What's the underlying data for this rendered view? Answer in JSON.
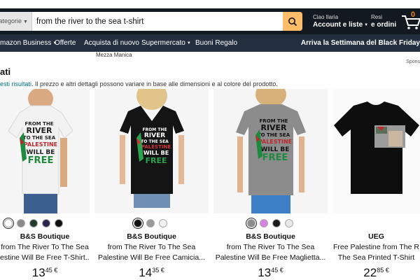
{
  "header": {
    "search_category": "categorie",
    "search_value": "from the river to the sea t-shirt",
    "account_greeting": "Ciao Ilaria",
    "account_label": "Account e liste",
    "returns_line1": "Resi",
    "returns_line2": "e ordini",
    "cart_count": "0"
  },
  "nav": {
    "items": [
      "mazon Business",
      "Offerte",
      "Acquista di nuovo",
      "Supermercato",
      "Buoni Regalo"
    ],
    "promo": "Arriva la Settimana del Black Friday"
  },
  "filter_subline": "Mezza Manica",
  "sponsored": "Spons",
  "results": {
    "heading": "ati",
    "help_link": "esti risultati",
    "help_text": ". Il prezzo e altri dettagli possono variare in base alle dimensioni e al colore del prodotto."
  },
  "products": [
    {
      "brand": "B&S Boutique",
      "title1": "from The River To The Sea",
      "title2": "estine Will Be Free T-Shirt...",
      "price_whole": "13",
      "price_cents": "45 €",
      "shirt_color": "#f2f2f2",
      "print": [
        "FROM THE",
        "RIVER",
        "TO THE SEA",
        "PALESTINE",
        "WILL BE",
        "FREE"
      ],
      "swatches": [
        "#ffffff",
        "#8a8a8a",
        "#1f3d2b",
        "#2b2450",
        "#111111"
      ]
    },
    {
      "brand": "B&S Boutique",
      "title1": "from The River To The Sea",
      "title2": "Palestine Will Be Free Camicia...",
      "price_whole": "14",
      "price_cents": "35 €",
      "shirt_color": "#141414",
      "print": [
        "FROM THE",
        "RIVER",
        "TO THE SEA",
        "PALESTINE",
        "WILL BE",
        "FREE"
      ],
      "swatches": [
        "#111111",
        "#9a9a9a",
        "#f2f2f2"
      ]
    },
    {
      "brand": "B&S Boutique",
      "title1": "from The River To The Sea",
      "title2": "Palestine Will Be Free Maglietta...",
      "price_whole": "13",
      "price_cents": "45 €",
      "shirt_color": "#8c8c8c",
      "print": [
        "FROM THE",
        "RIVER",
        "TO THE SEA",
        "PALESTINE",
        "WILL BE",
        "FREE"
      ],
      "swatches": [
        "#8c8c8c",
        "#d783e0",
        "#1b1b1b",
        "#e8e8e8"
      ]
    },
    {
      "brand": "UEG",
      "title1": "Free Palestine from The R",
      "title2": "The Sea Printed T-Shirt",
      "price_whole": "22",
      "price_cents": "85 €",
      "shirt_color": "#0e0e0e"
    }
  ]
}
